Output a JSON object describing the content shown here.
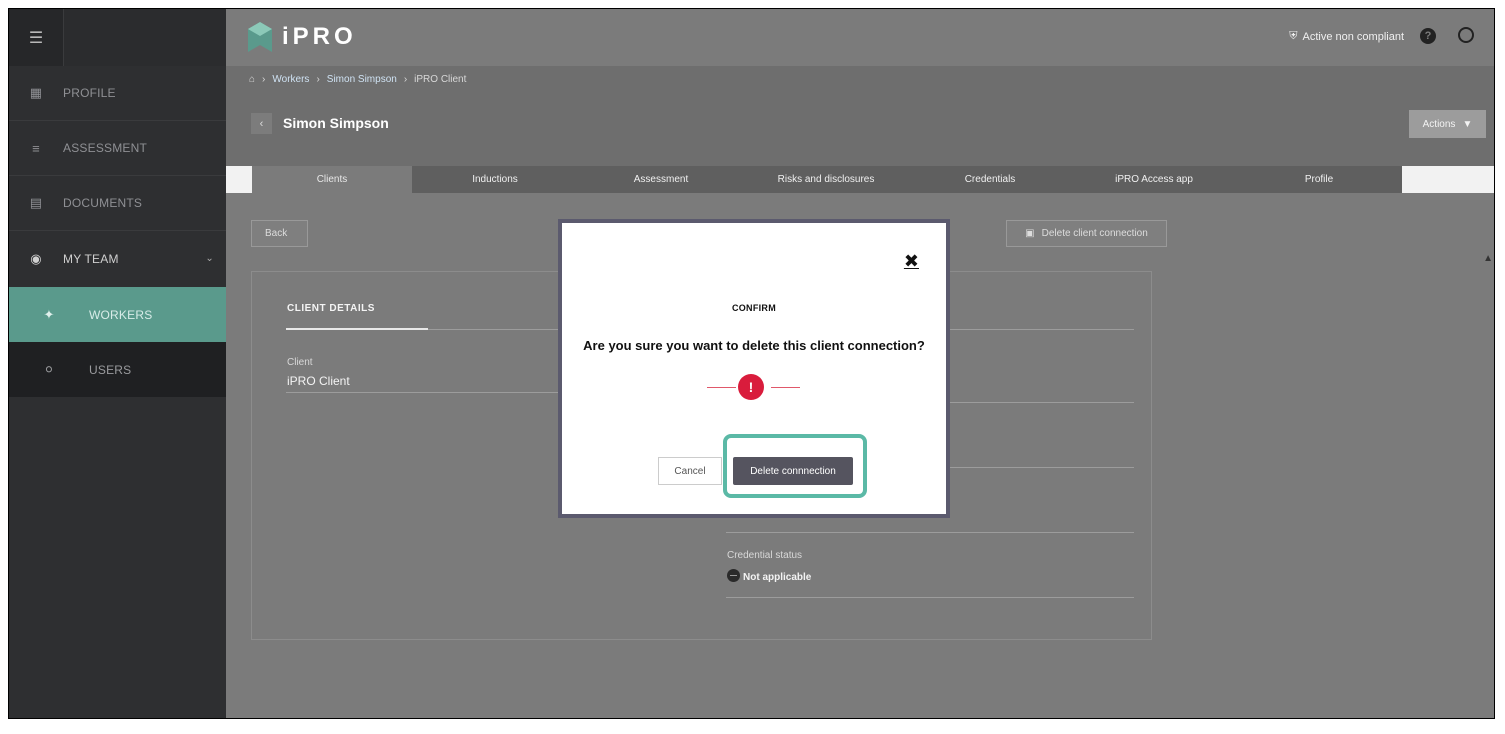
{
  "app": {
    "logo_text": "iPRO",
    "brand_color": "#5a9a8c"
  },
  "sidebar": {
    "menu_icon": "hamburger-icon",
    "items": [
      {
        "label": "PROFILE",
        "icon": "building-icon"
      },
      {
        "label": "ASSESSMENT",
        "icon": "list-icon"
      },
      {
        "label": "DOCUMENTS",
        "icon": "document-icon"
      },
      {
        "label": "MY TEAM",
        "icon": "user-circle-icon"
      }
    ],
    "subitems": [
      {
        "label": "WORKERS",
        "icon": "person-icon"
      },
      {
        "label": "USERS",
        "icon": "user-icon"
      }
    ]
  },
  "topbar": {
    "status": "Active non compliant",
    "help_icon": "?"
  },
  "breadcrumb": {
    "home_icon": "home-icon",
    "items": [
      "Workers",
      "Simon Simpson",
      "iPRO Client"
    ]
  },
  "header": {
    "name": "Simon Simpson",
    "actions_label": "Actions"
  },
  "tabs": [
    "Clients",
    "Inductions",
    "Assessment",
    "Risks and disclosures",
    "Credentials",
    "iPRO Access app",
    "Profile"
  ],
  "content": {
    "back_label": "Back",
    "delete_label": "Delete client connection",
    "card_title": "CLIENT DETAILS",
    "client_label": "Client",
    "client_value": "iPRO Client",
    "credential_status_label": "Credential status",
    "credential_status_value": "Not applicable"
  },
  "modal": {
    "title": "CONFIRM",
    "question": "Are you sure you want to delete this client connection?",
    "warning_icon": "!",
    "cancel_label": "Cancel",
    "confirm_label": "Delete connnection",
    "highlight_color": "#5bb9a6"
  }
}
